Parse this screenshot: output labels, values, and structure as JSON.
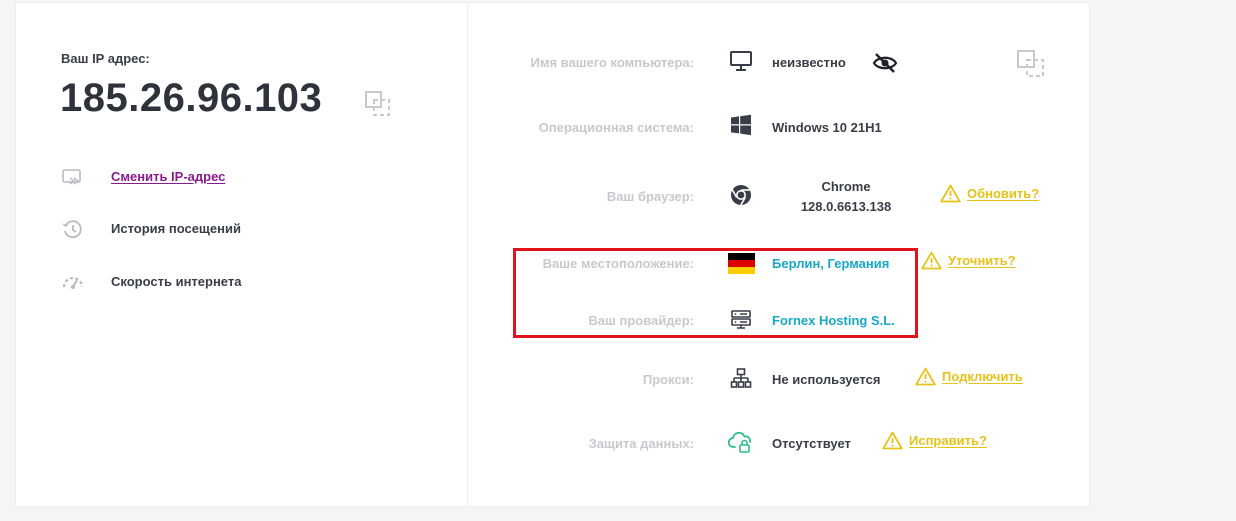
{
  "left": {
    "ip_label": "Ваш IP адрес:",
    "ip_value": "185.26.96.103",
    "menu": [
      {
        "label": "Сменить IP-адрес",
        "icon": "change-ip-icon",
        "link": true
      },
      {
        "label": "История посещений",
        "icon": "history-icon",
        "link": false
      },
      {
        "label": "Скорость интернета",
        "icon": "speed-icon",
        "link": false
      }
    ]
  },
  "rows": {
    "computer": {
      "label": "Имя вашего компьютера:",
      "value": "неизвестно",
      "icon": "monitor-icon"
    },
    "os": {
      "label": "Операционная система:",
      "value": "Windows 10 21H1",
      "icon": "windows-icon"
    },
    "browser": {
      "label": "Ваш браузер:",
      "value_line1": "Chrome",
      "value_line2": "128.0.6613.138",
      "icon": "chrome-icon",
      "action": "Обновить?"
    },
    "location": {
      "label": "Ваше местоположение:",
      "value": "Берлин, Германия",
      "icon": "germany-flag-icon",
      "action": "Уточнить?"
    },
    "provider": {
      "label": "Ваш провайдер:",
      "value": "Fornex Hosting S.L.",
      "icon": "server-icon"
    },
    "proxy": {
      "label": "Прокси:",
      "value": "Не используется",
      "icon": "network-icon",
      "action": "Подключить"
    },
    "protection": {
      "label": "Защита данных:",
      "value": "Отсутствует",
      "icon": "cloud-lock-icon",
      "action": "Исправить?"
    }
  },
  "colors": {
    "link_purple": "#8a1b8f",
    "value_blue": "#19a7c8",
    "warning_yellow": "#e6c21a",
    "label_gray": "#c7c9ce",
    "highlight_red": "#e3131b"
  }
}
